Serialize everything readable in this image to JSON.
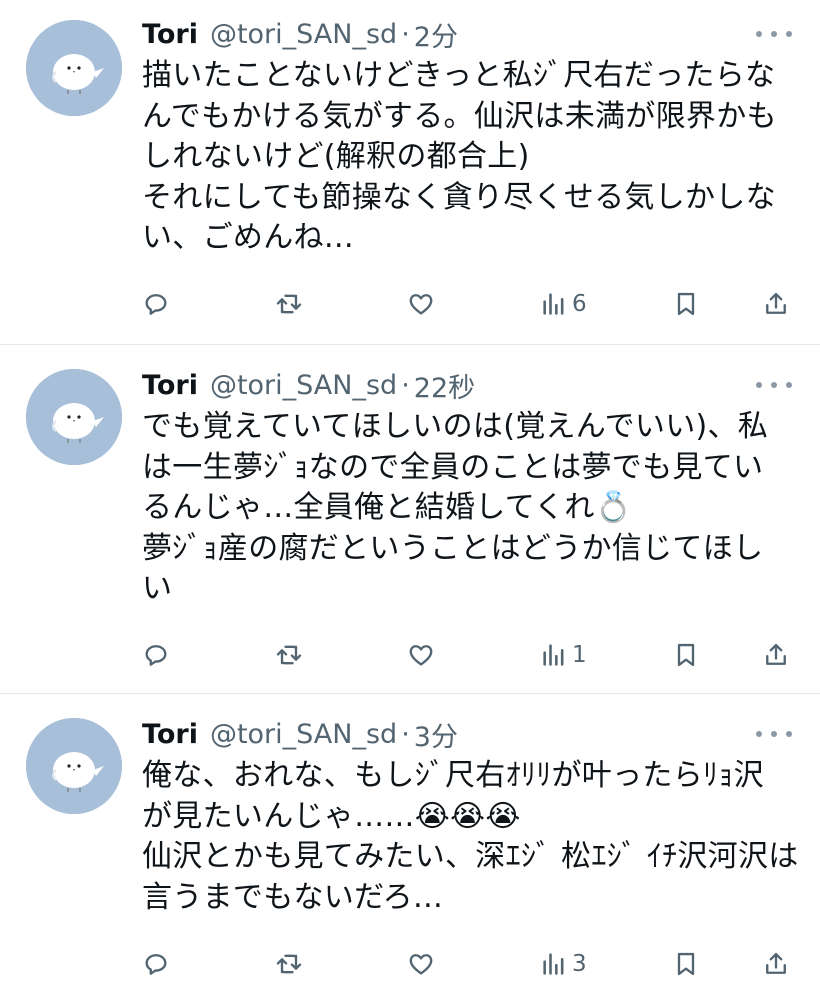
{
  "tweets": [
    {
      "name": "Tori",
      "handle": "@tori_SAN_sd",
      "separator": "·",
      "time": "2分",
      "lines": [
        "描いたことないけどきっと私ｼﾞ尺右だったらな",
        "んでもかける気がする。仙沢は未満が限界かも",
        "しれないけど(解釈の都合上)",
        "それにしても節操なく貪り尽くせる気しかしな",
        "い、ごめんね…"
      ],
      "views": "6"
    },
    {
      "name": "Tori",
      "handle": "@tori_SAN_sd",
      "separator": "·",
      "time": "22秒",
      "lines": [
        "でも覚えていてほしいのは(覚えんでいい)、私",
        "は一生夢ｼﾞｮなので全員のことは夢でも見てい",
        "るんじゃ…全員俺と結婚してくれ💍",
        "夢ｼﾞｮ産の腐だということはどうか信じてほし",
        "い"
      ],
      "views": "1"
    },
    {
      "name": "Tori",
      "handle": "@tori_SAN_sd",
      "separator": "·",
      "time": "3分",
      "lines": [
        "俺な、おれな、もしｼﾞ尺右ｵﾘﾘが叶ったらﾘｮ沢",
        "が見たいんじゃ……😭😭😭",
        "仙沢とかも見てみたい、深ｴｼﾞ 松ｴｼﾞ ｲﾁ沢河沢は",
        "言うまでもないだろ…"
      ],
      "views": "3"
    }
  ],
  "icons": {
    "reply": "reply-icon",
    "retweet": "retweet-icon",
    "like": "heart-icon",
    "views": "views-icon",
    "bookmark": "bookmark-icon",
    "share": "share-icon",
    "more": "more-icon"
  },
  "colors": {
    "text": "#0f1419",
    "secondary": "#536471",
    "avatar_bg": "#a7bfd8",
    "divider": "#e6e9eb"
  }
}
